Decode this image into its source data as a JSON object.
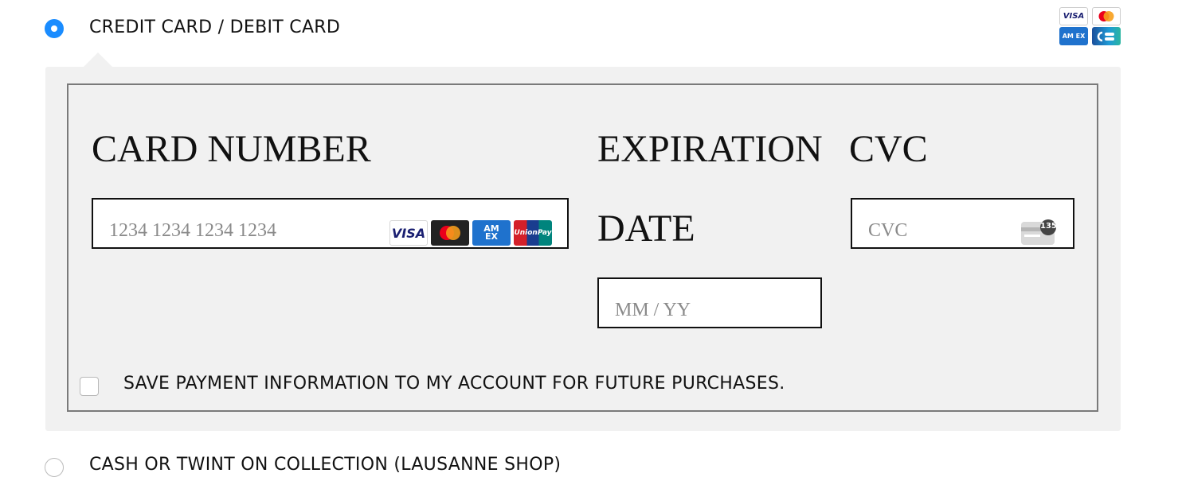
{
  "payment_methods": {
    "card_option": {
      "label": "CREDIT CARD / DEBIT CARD",
      "selected": true
    },
    "cash_option": {
      "label": "CASH OR TWINT ON COLLECTION (LAUSANNE SHOP)",
      "selected": false
    }
  },
  "accepted_brand_badges": {
    "visa": "VISA",
    "mastercard": "mastercard-icon",
    "amex": "AM EX",
    "cartes_bancaires": "cartes-bancaires-icon"
  },
  "card_form": {
    "card_number": {
      "label": "CARD NUMBER",
      "placeholder": "1234 1234 1234 1234"
    },
    "expiration": {
      "label": "EXPIRATION DATE",
      "placeholder": "MM / YY"
    },
    "cvc": {
      "label": "CVC",
      "placeholder": "CVC"
    },
    "card_brands": {
      "visa": "VISA",
      "mastercard": "mastercard-icon",
      "amex_line1": "AM",
      "amex_line2": "EX",
      "unionpay": "UnionPay"
    },
    "cvc_badge": "135"
  },
  "save_payment": {
    "label": "SAVE PAYMENT INFORMATION TO MY ACCOUNT FOR FUTURE PURCHASES.",
    "checked": false
  },
  "colors": {
    "accent": "#1a8cff",
    "panel_bg": "#f1f1f1",
    "frame_border": "#7a7a7a"
  }
}
